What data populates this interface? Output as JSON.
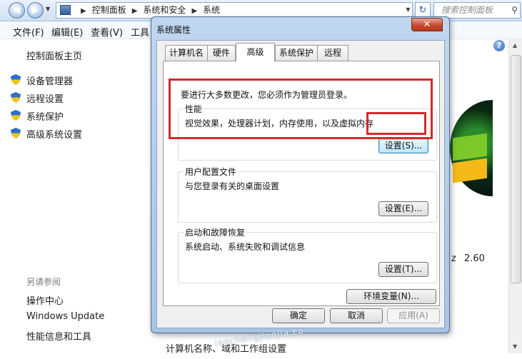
{
  "explorer": {
    "breadcrumb": [
      "控制面板",
      "系统和安全",
      "系统"
    ],
    "search_placeholder": "搜索控制面板",
    "menu": [
      "文件(F)",
      "编辑(E)",
      "查看(V)",
      "工具"
    ],
    "left_pane": {
      "home": "控制面板主页",
      "tasks": [
        "设备管理器",
        "远程设置",
        "系统保护",
        "高级系统设置"
      ],
      "see_also_heading": "另请参阅",
      "see_also_links": [
        "操作中心",
        "Windows Update",
        "性能信息和工具"
      ]
    },
    "main": {
      "speed_fragment": "z",
      "speed_value": "2.60",
      "computer_name_section": "计算机名称、域和工作组设置"
    },
    "watermark": "iaochengjianjia.co"
  },
  "dialog": {
    "title": "系统属性",
    "close_label": "✕",
    "tabs": [
      {
        "label": "计算机名",
        "active": false
      },
      {
        "label": "硬件",
        "active": false
      },
      {
        "label": "高级",
        "active": true
      },
      {
        "label": "系统保护",
        "active": false
      },
      {
        "label": "远程",
        "active": false
      }
    ],
    "admin_note": "要进行大多数更改，您必须作为管理员登录。",
    "groups": [
      {
        "title": "性能",
        "description": "视觉效果，处理器计划，内存使用，以及虚拟内存",
        "button": "设置(S)...",
        "highlighted": true
      },
      {
        "title": "用户配置文件",
        "description": "与您登录有关的桌面设置",
        "button": "设置(E)...",
        "highlighted": false
      },
      {
        "title": "启动和故障恢复",
        "description": "系统启动、系统失败和调试信息",
        "button": "设置(T)...",
        "highlighted": false
      }
    ],
    "env_button": "环境变量(N)...",
    "ok_button": "确定",
    "cancel_button": "取消",
    "apply_button": "应用(A)",
    "highlight_color": "#d42a2a"
  }
}
